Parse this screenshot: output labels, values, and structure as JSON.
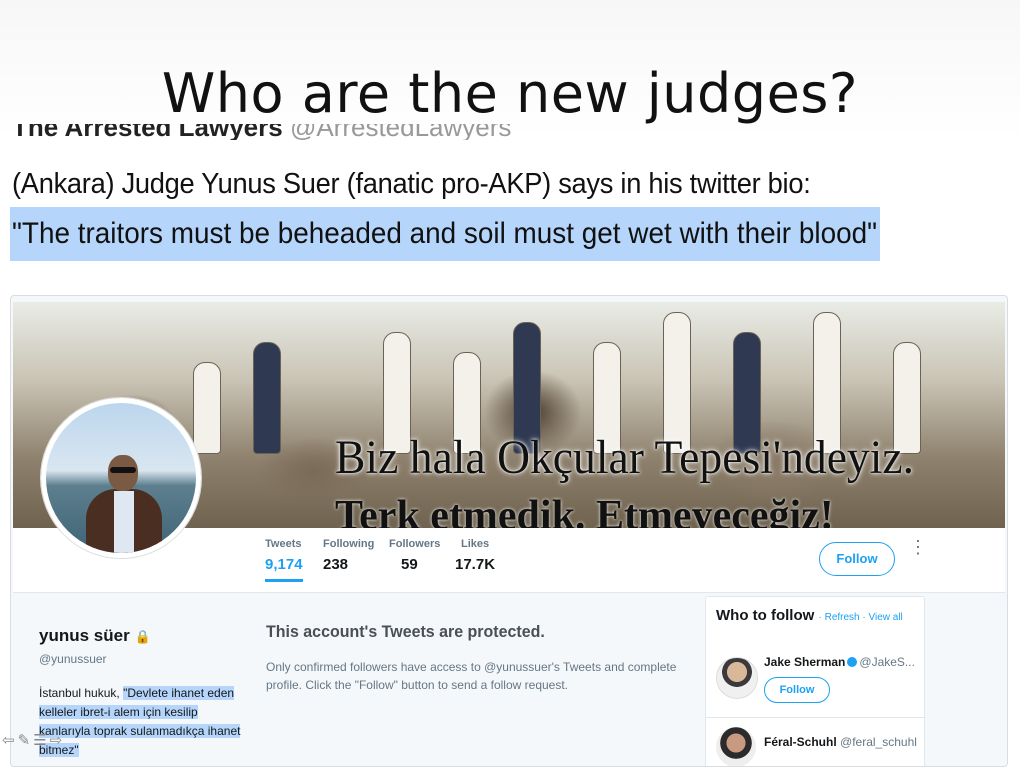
{
  "slide": {
    "title": "Who are the new judges?",
    "cutoff_text": "The Arrested Lawyers",
    "cutoff_handle": "@ArrestedLawyers",
    "line1": "(Ankara) Judge Yunus Suer (fanatic pro-AKP) says in his twitter bio:",
    "line2": "\"The traitors must be beheaded and soil must get wet with their blood\""
  },
  "profile": {
    "banner_line1": "Biz hala Okçular Tepesi'ndeyiz.",
    "banner_line2": "Terk etmedik. Etmeyeceğiz!",
    "stats": [
      {
        "label": "Tweets",
        "value": "9,174"
      },
      {
        "label": "Following",
        "value": "238"
      },
      {
        "label": "Followers",
        "value": "59"
      },
      {
        "label": "Likes",
        "value": "17.7K"
      }
    ],
    "follow_label": "Follow",
    "more_icon": "⋮",
    "name": "yunus süer",
    "lock_icon": "🔒",
    "handle": "@yunussuer",
    "bio_prefix": "İstanbul hukuk, ",
    "bio_highlight": "\"Devlete ihanet eden kelleler ibret-i alem için kesilip kanlarıyla toprak sulanmadıkça ihanet bitmez\""
  },
  "protected": {
    "title": "This account's Tweets are protected.",
    "text": "Only confirmed followers have access to @yunussuer's Tweets and complete profile. Click the \"Follow\" button to send a follow request."
  },
  "who_to_follow": {
    "title": "Who to follow",
    "refresh": "Refresh",
    "view_all": "View all",
    "sep": " · ",
    "items": [
      {
        "name": "Jake Sherman",
        "handle": "@JakeS...",
        "follow": "Follow"
      },
      {
        "name": "Féral-Schuhl",
        "handle": "@feral_schuhl"
      }
    ]
  },
  "slide_nav": [
    "⇦",
    "✎",
    "☰",
    "⇨"
  ]
}
